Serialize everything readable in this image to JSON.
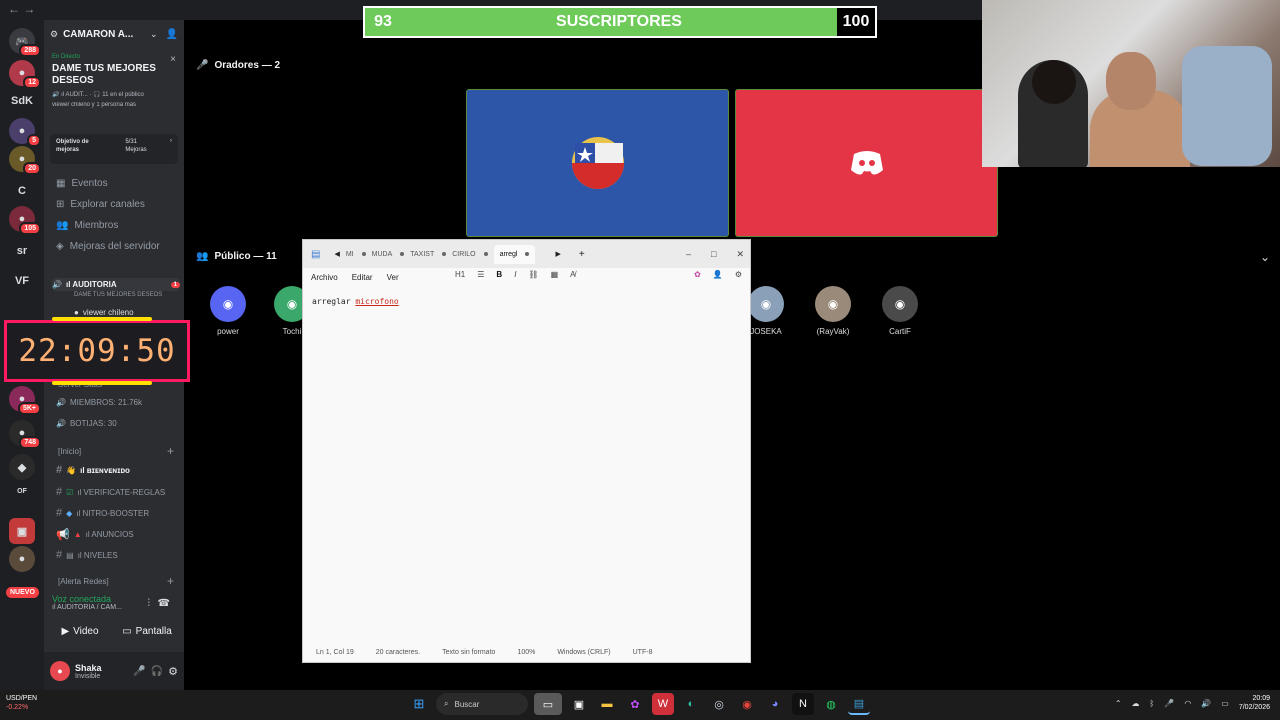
{
  "subscriber_bar": {
    "current": "93",
    "label": "SUSCRIPTORES",
    "goal": "100"
  },
  "server": {
    "name": "CAMARÓN A..."
  },
  "event": {
    "live_label": "En Directo",
    "title": "DAME TUS MEJORES DESEOS",
    "meta_line": "🔊 ıl AUDIT... · 🎧 11 en el público",
    "viewers_line": "viewer chileno y 1 persona más"
  },
  "goal": {
    "label": "Objetivo de mejoras",
    "count": "5/31",
    "unit": "Mejoras"
  },
  "nav": [
    "Eventos",
    "Explorar canales",
    "Miembros",
    "Mejoras del servidor"
  ],
  "voice_channel": {
    "name": "ıl AUDITORIA",
    "topic": "DAME TUS MEJORES DESEOS",
    "badge": "1",
    "member": "viewer chileno"
  },
  "timer": "22:09:50",
  "stats": {
    "category": "Server Stats",
    "members": "MIEMBROS: 21.76k",
    "bots": "BOTIJAS: 30"
  },
  "inicio": {
    "category": "[Inicio]",
    "channels": [
      "ıl ʙɪᴇɴᴠᴇɴɪᴅᴏ",
      "ıl VERIFICATE-REGLAS",
      "ıl NITRO-BOOSTER",
      "ıl ANUNCIOS",
      "ıl NIVELES"
    ]
  },
  "alerta": "[Alerta Redes]",
  "voice_connected": {
    "title": "Voz conectada",
    "sub": "ıl AUDITORIA / CAM..."
  },
  "video_btn": "Video",
  "screen_btn": "Pantalla",
  "user": {
    "name": "Shaka",
    "status": "Invisible"
  },
  "server_list": {
    "badges": [
      "288",
      "12",
      "5",
      "20",
      "105",
      "5K+",
      "748"
    ],
    "labels": [
      "SdK",
      "C",
      "sr",
      "VF",
      "OF"
    ],
    "new_label": "NUEVO"
  },
  "speakers": {
    "label": "Oradores — 2"
  },
  "audience": {
    "label": "Público — 11",
    "members": [
      "power",
      "Tochi",
      "JOSEKA",
      "(RayVak)",
      "CartiF"
    ]
  },
  "notepad": {
    "tabs": [
      "MI",
      "MUDA",
      "TAXIST",
      "CIRILO",
      "arregl"
    ],
    "menu": [
      "Archivo",
      "Editar",
      "Ver"
    ],
    "heading_tool": "H1",
    "text_a": "arreglar ",
    "text_b": "microfono",
    "status": [
      "Ln 1, Col 19",
      "20 caracteres.",
      "Texto sin formato",
      "100%",
      "Windows (CRLF)",
      "UTF-8"
    ]
  },
  "taskbar": {
    "ticker": "USD/PEN",
    "change": "-0.22%",
    "search": "Buscar",
    "time": "20:09",
    "date": "7/02/2026"
  },
  "colors": {
    "accent_green": "#23a55a",
    "discord_red": "#e33546",
    "chile_blue": "#2d56a8",
    "timer_border": "#ff1a62"
  }
}
